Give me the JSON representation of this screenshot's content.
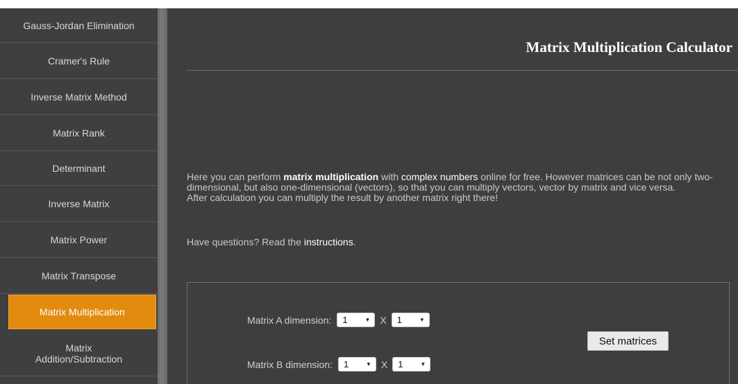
{
  "sidebar": {
    "items": [
      {
        "label": "Gauss-Jordan Elimination",
        "active": false
      },
      {
        "label": "Cramer's Rule",
        "active": false
      },
      {
        "label": "Inverse Matrix Method",
        "active": false
      },
      {
        "label": "Matrix Rank",
        "active": false
      },
      {
        "label": "Determinant",
        "active": false
      },
      {
        "label": "Inverse Matrix",
        "active": false
      },
      {
        "label": "Matrix Power",
        "active": false
      },
      {
        "label": "Matrix Transpose",
        "active": false
      },
      {
        "label": "Matrix Multiplication",
        "active": true
      },
      {
        "label": "Matrix\nAddition/Subtraction",
        "active": false
      }
    ]
  },
  "main": {
    "title": "Matrix Multiplication Calculator",
    "intro": {
      "t1": "Here you can perform ",
      "b1": "matrix multiplication",
      "t2": " with ",
      "link1": "complex numbers",
      "t3": " online for free. However matrices can be not only two-dimensional, but also one-dimensional (vectors), so that you can multiply vectors, vector by matrix and vice versa.",
      "line2": "After calculation you can multiply the result by another matrix right there!"
    },
    "question": {
      "t1": "Have questions? Read the ",
      "link": "instructions",
      "t2": "."
    }
  },
  "form": {
    "matrix_a_label": "Matrix A dimension:",
    "matrix_a_rows": "1",
    "matrix_a_cols": "1",
    "matrix_b_label": "Matrix B dimension:",
    "matrix_b_rows": "1",
    "matrix_b_cols": "1",
    "times_symbol": "X",
    "set_button": "Set matrices"
  },
  "colors": {
    "accent": "#e28b0f",
    "background": "#3e3e3e"
  }
}
